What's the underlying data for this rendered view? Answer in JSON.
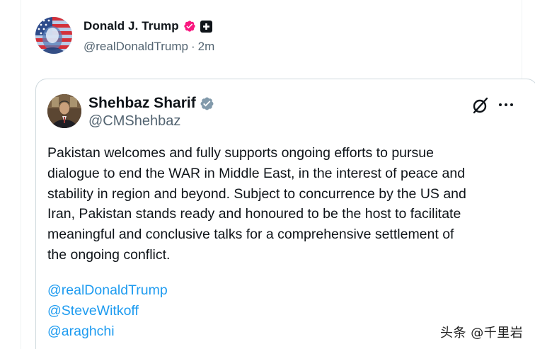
{
  "outer_post": {
    "author_name": "Donald J. Trump",
    "author_handle": "@realDonaldTrump",
    "separator": "·",
    "time_ago": "2m",
    "avatar_icon": "avatar-flag-portrait",
    "verified_badge_color": "#f91880",
    "verified_icon": "verified-badge-icon",
    "affiliate_icon": "affiliate-plus-icon"
  },
  "quoted_post": {
    "author_name": "Shehbaz Sharif",
    "author_handle": "@CMShehbaz",
    "verified_badge_color": "#829aab",
    "verified_icon": "gray-verified-badge-icon",
    "grok_icon": "grok-icon",
    "more_icon": "more-options-icon",
    "text": "Pakistan welcomes and fully supports ongoing efforts to pursue\ndialogue to end the WAR in Middle East, in the interest of peace and\nstability in region and beyond. Subject to concurrence by the US and\nIran, Pakistan stands ready and honoured to be the host to facilitate\nmeaningful and conclusive talks for a comprehensive settlement of\nthe ongoing conflict.",
    "mentions": [
      "@realDonaldTrump",
      "@SteveWitkoff",
      "@araghchi"
    ]
  },
  "watermark": "头条 @千里岩",
  "colors": {
    "text_primary": "#0f1419",
    "text_secondary": "#536471",
    "link": "#1d9bf0",
    "border": "#cfd9de"
  }
}
